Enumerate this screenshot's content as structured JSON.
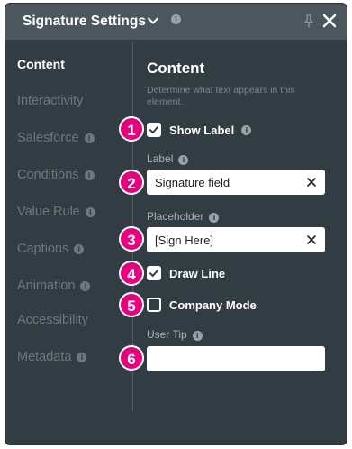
{
  "header": {
    "title": "Signature Settings"
  },
  "sidebar": {
    "items": [
      {
        "label": "Content",
        "active": true,
        "info": false
      },
      {
        "label": "Interactivity",
        "active": false,
        "info": false
      },
      {
        "label": "Salesforce",
        "active": false,
        "info": true
      },
      {
        "label": "Conditions",
        "active": false,
        "info": true
      },
      {
        "label": "Value Rule",
        "active": false,
        "info": true
      },
      {
        "label": "Captions",
        "active": false,
        "info": true
      },
      {
        "label": "Animation",
        "active": false,
        "info": true
      },
      {
        "label": "Accessibility",
        "active": false,
        "info": false
      },
      {
        "label": "Metadata",
        "active": false,
        "info": true
      }
    ]
  },
  "content": {
    "title": "Content",
    "description": "Determine what text appears in this element.",
    "show_label": {
      "label": "Show Label",
      "checked": true
    },
    "label_field": {
      "label": "Label",
      "value": "Signature field"
    },
    "placeholder_field": {
      "label": "Placeholder",
      "value": "[Sign Here]"
    },
    "draw_line": {
      "label": "Draw Line",
      "checked": true
    },
    "company_mode": {
      "label": "Company Mode",
      "checked": false
    },
    "user_tip": {
      "label": "User Tip",
      "value": ""
    }
  },
  "badges": [
    "1",
    "2",
    "3",
    "4",
    "5",
    "6"
  ],
  "colors": {
    "panel": "#323c43",
    "header": "#4b565d",
    "badge": "#e6007e"
  },
  "icons": {
    "title_dropdown": "chevron-down-icon",
    "info": "info-icon",
    "pin": "pin-icon",
    "close": "close-icon",
    "clear": "clear-x-icon",
    "check": "checkmark-icon"
  }
}
